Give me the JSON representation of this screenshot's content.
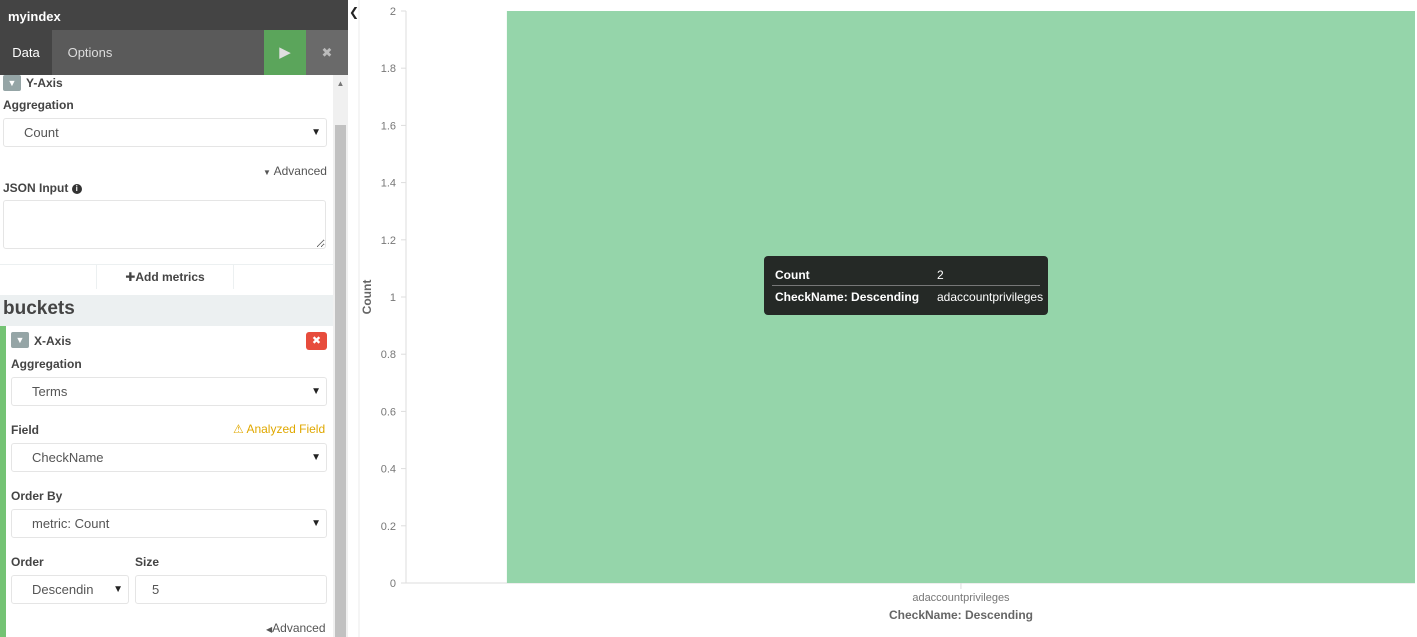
{
  "sidebar": {
    "index_title": "myindex",
    "tabs": [
      {
        "label": "Data"
      },
      {
        "label": "Options"
      }
    ],
    "apply_icon": "play-icon",
    "discard_icon": "close-icon"
  },
  "metrics": {
    "yaxis_label": "Y-Axis",
    "aggregation_label": "Aggregation",
    "aggregation_value": "Count",
    "advanced_label": "Advanced",
    "json_input_label": "JSON Input",
    "json_input_value": "",
    "add_metrics_label": "Add metrics"
  },
  "buckets": {
    "title": "buckets",
    "xaxis_label": "X-Axis",
    "aggregation_label": "Aggregation",
    "aggregation_value": "Terms",
    "field_label": "Field",
    "field_warning": "Analyzed Field",
    "field_value": "CheckName",
    "order_by_label": "Order By",
    "order_by_value": "metric: Count",
    "order_label": "Order",
    "order_value": "Descendin",
    "size_label": "Size",
    "size_value": "5",
    "advanced_label": "Advanced"
  },
  "tooltip": {
    "rows": [
      {
        "key": "Count",
        "value": "2"
      },
      {
        "key": "CheckName: Descending",
        "value": "adaccountprivileges"
      }
    ]
  },
  "colors": {
    "bar": "#95d5aa",
    "apply": "#5cb85c",
    "remove": "#e74c3c",
    "warning": "#e0a800"
  },
  "chart_data": {
    "type": "bar",
    "categories": [
      "adaccountprivileges"
    ],
    "values": [
      2
    ],
    "xlabel": "CheckName: Descending",
    "ylabel": "Count",
    "ylim": [
      0,
      2
    ],
    "yticks": [
      "0",
      "0.2",
      "0.4",
      "0.6",
      "0.8",
      "1",
      "1.2",
      "1.4",
      "1.6",
      "1.8",
      "2"
    ],
    "grid": false,
    "legend": "none"
  }
}
